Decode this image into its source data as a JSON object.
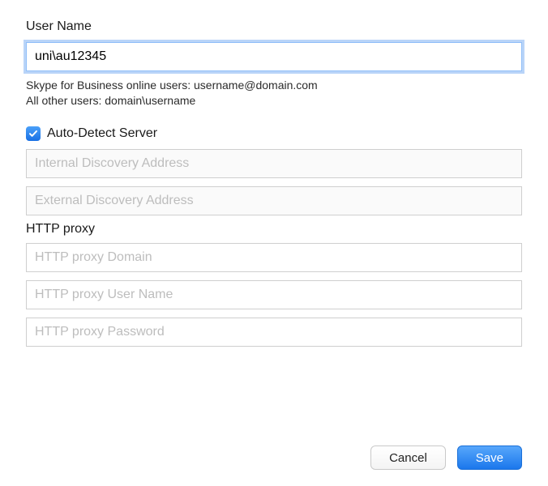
{
  "username": {
    "label": "User Name",
    "value": "uni\\au12345",
    "hint_line1": "Skype for Business online users: username@domain.com",
    "hint_line2": "All other users: domain\\username"
  },
  "autoDetect": {
    "label": "Auto-Detect Server",
    "checked": true
  },
  "discovery": {
    "internal_placeholder": "Internal Discovery Address",
    "external_placeholder": "External Discovery Address"
  },
  "httpProxy": {
    "section_label": "HTTP proxy",
    "domain_placeholder": "HTTP proxy Domain",
    "username_placeholder": "HTTP proxy User Name",
    "password_placeholder": "HTTP proxy Password"
  },
  "buttons": {
    "cancel": "Cancel",
    "save": "Save"
  }
}
